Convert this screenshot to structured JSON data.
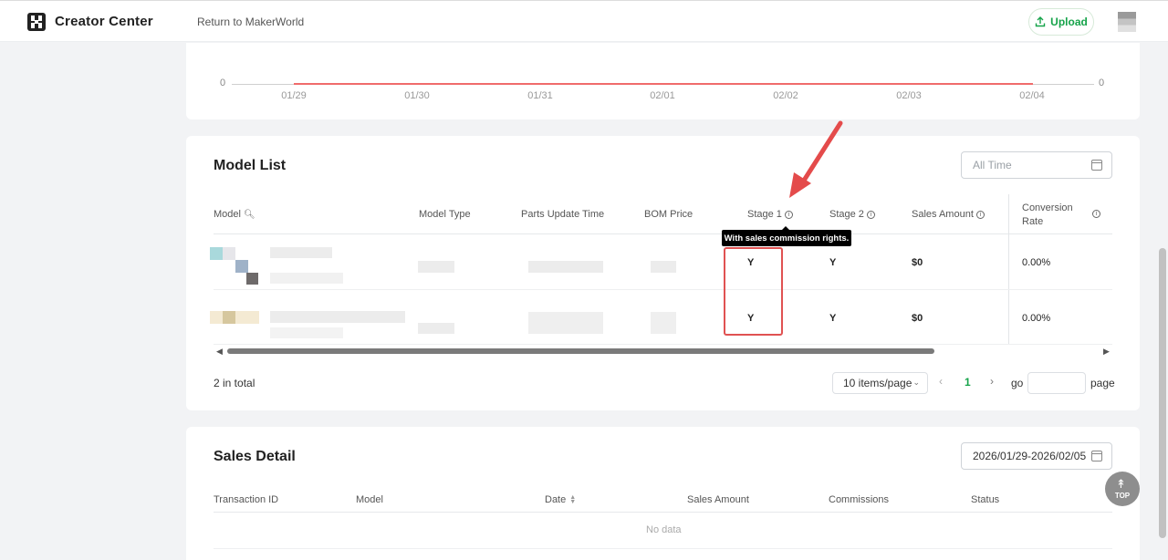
{
  "header": {
    "brand": "Creator Center",
    "return_link": "Return to MakerWorld",
    "upload_label": "Upload"
  },
  "trend_chart": {
    "y_left": "0",
    "y_right": "0",
    "x_ticks": [
      "01/29",
      "01/30",
      "01/31",
      "02/01",
      "02/02",
      "02/03",
      "02/04"
    ],
    "series_color": "#f06b6b"
  },
  "model_list": {
    "title": "Model List",
    "date_placeholder": "All Time",
    "columns": {
      "model": "Model",
      "model_type": "Model Type",
      "parts_update_time": "Parts Update Time",
      "bom_price": "BOM Price",
      "stage1": "Stage 1",
      "stage2": "Stage 2",
      "sales_amount": "Sales Amount",
      "conversion_rate": "Conversion Rate"
    },
    "rows": [
      {
        "stage1": "Y",
        "stage2": "Y",
        "sales_amount": "$0",
        "conversion_rate": "0.00%"
      },
      {
        "stage1": "Y",
        "stage2": "Y",
        "sales_amount": "$0",
        "conversion_rate": "0.00%"
      }
    ],
    "tooltip": "With sales commission rights.",
    "total": "2 in total",
    "page_size": "10 items/page",
    "current_page": "1",
    "go_label": "go",
    "page_label": "page"
  },
  "sales_detail": {
    "title": "Sales Detail",
    "date_range": "2026/01/29-2026/02/05",
    "columns": {
      "transaction_id": "Transaction ID",
      "model": "Model",
      "date": "Date",
      "sales_amount": "Sales Amount",
      "commissions": "Commissions",
      "status": "Status"
    },
    "empty_text": "No data"
  },
  "back_to_top": "TOP",
  "colors": {
    "accent_green": "#16a34a",
    "highlight_red": "#e05252"
  }
}
